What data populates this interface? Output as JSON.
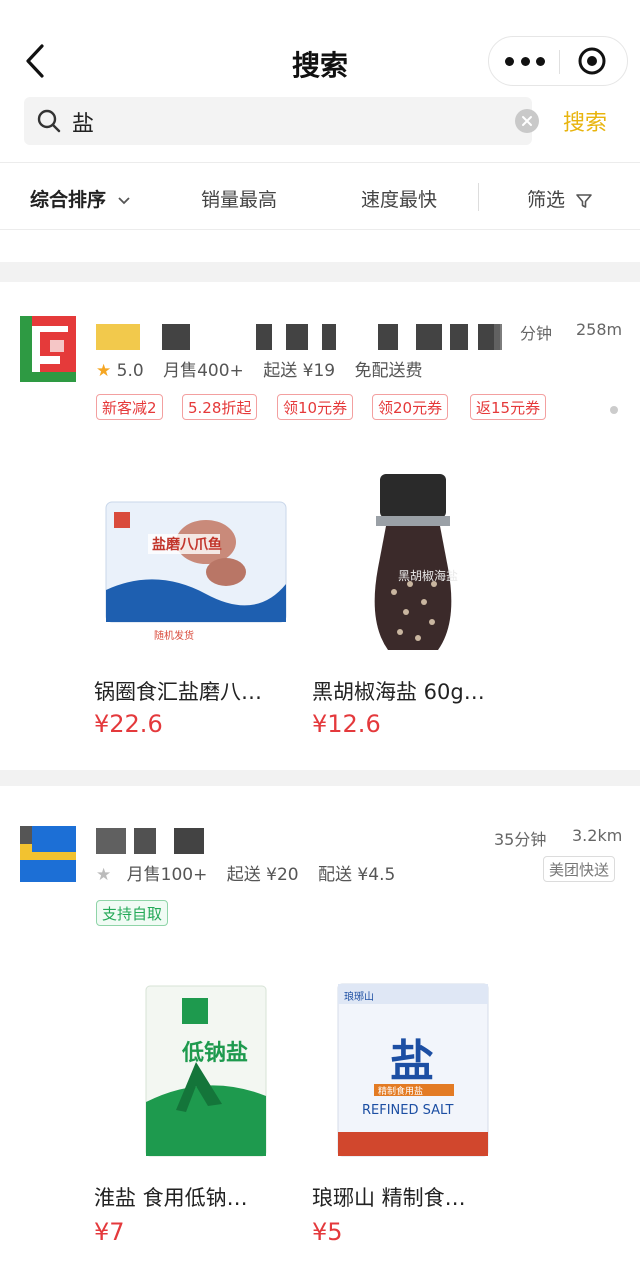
{
  "header": {
    "title": "搜索"
  },
  "search": {
    "query": "盐",
    "button": "搜索"
  },
  "filters": [
    {
      "label": "综合排序"
    },
    {
      "label": "销量最高"
    },
    {
      "label": "速度最快"
    },
    {
      "label": "筛选"
    }
  ],
  "stores": [
    {
      "time": "分钟",
      "distance": "258m",
      "rating": "5.0",
      "monthly_sales": "月售400+",
      "min_order": "起送 ¥19",
      "delivery_fee": "免配送费",
      "tags": [
        "新客减2",
        "5.28折起",
        "领10元券",
        "领20元券",
        "返15元券"
      ],
      "products": [
        {
          "name": "锅圈食汇盐磨八…",
          "price": "¥22.6",
          "package_text": "盐磨八爪鱼",
          "package_note": "随机发货"
        },
        {
          "name": "黑胡椒海盐 60g…",
          "price": "¥12.6",
          "package_text": "黑胡椒海盐"
        }
      ]
    },
    {
      "time": "35分钟",
      "distance": "3.2km",
      "monthly_sales": "月售100+",
      "min_order": "起送 ¥20",
      "delivery_fee": "配送 ¥4.5",
      "delivery_badge": "美团快送",
      "tags": [
        "支持自取"
      ],
      "products": [
        {
          "name": "淮盐 食用低钠…",
          "price": "¥7",
          "package_text": "低钠盐"
        },
        {
          "name": "琅琊山 精制食…",
          "price": "¥5",
          "package_text": "盐",
          "package_sub": "精制食用盐",
          "package_en": "REFINED SALT",
          "package_brand": "琅琊山"
        }
      ]
    }
  ],
  "colors": {
    "accent": "#e8b40e",
    "price": "#e4393c",
    "tag_red": "#e5393a",
    "tag_green": "#23a957"
  }
}
